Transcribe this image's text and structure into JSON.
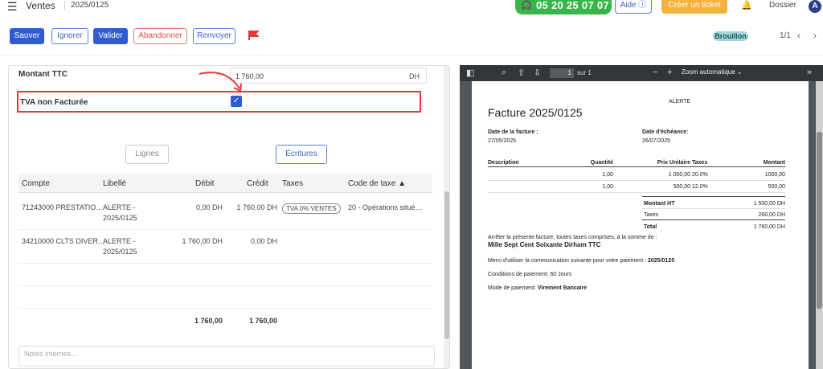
{
  "topbar": {
    "title": "Ventes",
    "ref": "2025/0125",
    "phone": "05 20 25 07 07",
    "help": "Aide ⓘ",
    "ticket": "Créer un ticket",
    "dossier": "Dossier",
    "avatar": "A"
  },
  "toolbar": {
    "save": "Sauver",
    "ignore": "Ignorer",
    "validate": "Valider",
    "abandon": "Abandonner",
    "resend": "Renvoyer",
    "status": "Brouillon",
    "pager": "1/1"
  },
  "form": {
    "ttc_label": "Montant TTC",
    "ttc_value": "1 760,00",
    "ttc_unit": "DH",
    "tva_label": "TVA non Facturée",
    "tva_checked": true
  },
  "tabs": {
    "lines": "Lignes",
    "entries": "Écritures"
  },
  "entries": {
    "headers": [
      "Compte",
      "Libellé",
      "Débit",
      "Crédit",
      "Taxes",
      "Code de taxe ▲"
    ],
    "rows": [
      {
        "account": "71243000 PRESTATIO…",
        "label": "ALERTE - 2025/0125",
        "debit": "0,00 DH",
        "credit": "1 760,00 DH",
        "tax": "TVA 0% VENTES",
        "tax_code": "20 - Opérations situé…"
      },
      {
        "account": "34210000 CLTS DIVER…",
        "label": "ALERTE - 2025/0125",
        "debit": "1 760,00 DH",
        "credit": "0,00 DH",
        "tax": "",
        "tax_code": ""
      }
    ],
    "total_debit": "1 760,00",
    "total_credit": "1 760,00"
  },
  "notes_placeholder": "Notes internes...",
  "pdf": {
    "page": "1",
    "of": "sur 1",
    "zoom": "Zoom automatique",
    "company": "ALERTE",
    "title": "Facture 2025/0125",
    "invoice_date_label": "Date de la facture :",
    "invoice_date": "27/05/2025",
    "due_date_label": "Date d'échéance:",
    "due_date": "26/07/2025",
    "headers": [
      "Description",
      "Quantité",
      "Prix Unitaire",
      "Taxes",
      "Montant"
    ],
    "lines": [
      {
        "qty": "1,00",
        "price": "1 000,00",
        "tax": "20.0%",
        "amount": "1000,00"
      },
      {
        "qty": "1,00",
        "price": "500,00",
        "tax": "12.0%",
        "amount": "500,00"
      }
    ],
    "ht_label": "Montant HT",
    "ht_value": "1 500,00 DH",
    "taxes_label": "Taxes",
    "taxes_value": "260,00 DH",
    "total_label": "Total",
    "total_value": "1 760,00 DH",
    "arrete": "Arrêter la présente facture, toutes taxes comprises, à la somme de :",
    "amount_words": "Mille Sept Cent Soixante Dirham TTC",
    "comm_prefix": "Merci d'utiliser la communication suivante pour votre paiement :",
    "comm_value": "2025/0125",
    "conditions": "Conditions de paiement: 60 Jours",
    "mode_prefix": "Mode de paiement:",
    "mode_value": "Virement Bancaire"
  },
  "colors": {
    "primary": "#2f5bd3",
    "highlight": "#e23a3a",
    "phone": "#3bb54a",
    "ticket": "#f4b13e"
  }
}
